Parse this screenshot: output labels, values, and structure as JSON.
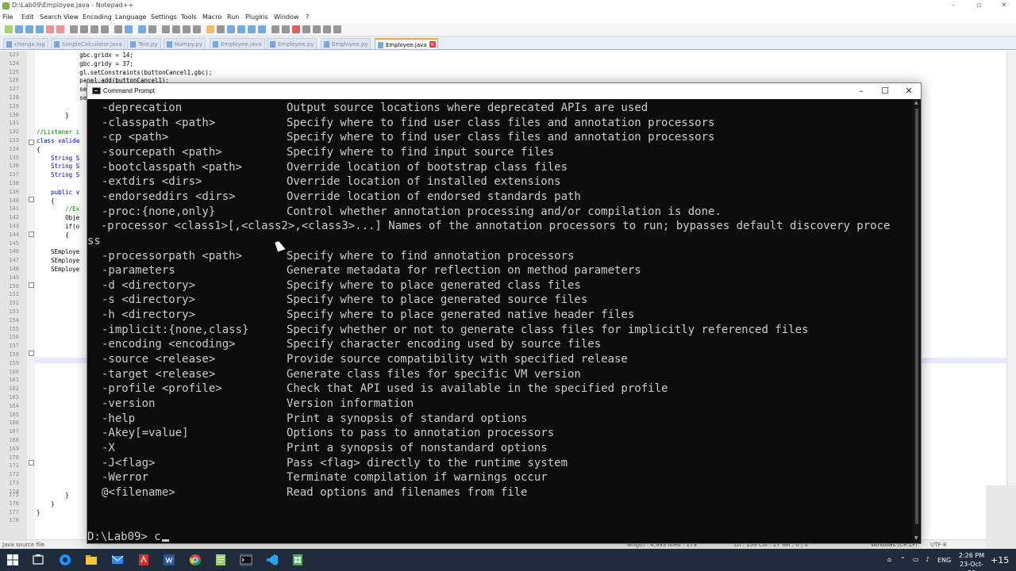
{
  "npp": {
    "title": "D:\\Lab09\\Employee.java - Notepad++",
    "menu": [
      "File",
      "Edit",
      "Search",
      "View",
      "Encoding",
      "Language",
      "Settings",
      "Tools",
      "Macro",
      "Run",
      "Plugins",
      "Window",
      "?"
    ],
    "tabs": [
      "change.log",
      "SimpleCalculator.java",
      "Test.py",
      "Numpy.py",
      "Employee.java",
      "Employee.py",
      "Employee.py",
      "Employee.java"
    ],
    "active_tab": 7,
    "code_lines": [
      {
        "n": "123",
        "t": "            gbc.gridx = 14;"
      },
      {
        "n": "124",
        "t": "            gbc.gridy = 37;"
      },
      {
        "n": "125",
        "t": "            gl.setConstraints(buttonCancel1,gbc);"
      },
      {
        "n": "126",
        "t": "            panel.add(buttonCancel1);"
      },
      {
        "n": "127",
        "t": "            setS"
      },
      {
        "n": "128",
        "t": "            setV"
      },
      {
        "n": "129",
        "t": ""
      },
      {
        "n": "130",
        "t": "        }"
      },
      {
        "n": "131",
        "t": ""
      },
      {
        "n": "132",
        "t": "//Listener i"
      },
      {
        "n": "133",
        "t": "class valida"
      },
      {
        "n": "134",
        "t": "{"
      },
      {
        "n": "135",
        "t": "    String S"
      },
      {
        "n": "136",
        "t": "    String S"
      },
      {
        "n": "137",
        "t": "    String S"
      },
      {
        "n": "138",
        "t": ""
      },
      {
        "n": "139",
        "t": "    public v"
      },
      {
        "n": "140",
        "t": "    {"
      },
      {
        "n": "141",
        "t": "        //Ex"
      },
      {
        "n": "142",
        "t": "        Obje"
      },
      {
        "n": "143",
        "t": "        if(o"
      },
      {
        "n": "144",
        "t": "        {"
      },
      {
        "n": "145",
        "t": ""
      },
      {
        "n": "146",
        "t": "    SEmploye"
      },
      {
        "n": "147",
        "t": "    SEmploye"
      },
      {
        "n": "148",
        "t": "    SEmploye"
      }
    ],
    "tail_lines": [
      {
        "n": "175",
        "t": "        }"
      },
      {
        "n": "176",
        "t": "    }"
      },
      {
        "n": "177",
        "t": "}"
      },
      {
        "n": "178",
        "t": ""
      }
    ],
    "status": {
      "filetype": "Java source file",
      "length": "length : 4,993    lines : 179",
      "position": "Ln : 159    Col : 17    Sel : 0 | 0",
      "eol": "Windows (CR LF)",
      "encoding": "UTF-8"
    }
  },
  "cmd": {
    "title": "Command Prompt",
    "lines": [
      {
        "opt": "-deprecation",
        "desc": "Output source locations where deprecated APIs are used"
      },
      {
        "opt": "-classpath <path>",
        "desc": "Specify where to find user class files and annotation processors"
      },
      {
        "opt": "-cp <path>",
        "desc": "Specify where to find user class files and annotation processors"
      },
      {
        "opt": "-sourcepath <path>",
        "desc": "Specify where to find input source files"
      },
      {
        "opt": "-bootclasspath <path>",
        "desc": "Override location of bootstrap class files"
      },
      {
        "opt": "-extdirs <dirs>",
        "desc": "Override location of installed extensions"
      },
      {
        "opt": "-endorseddirs <dirs>",
        "desc": "Override location of endorsed standards path"
      },
      {
        "opt": "-proc:{none,only}",
        "desc": "Control whether annotation processing and/or compilation is done."
      }
    ],
    "wrapped_line_1": "  -processor <class1>[,<class2>,<class3>...] Names of the annotation processors to run; bypasses default discovery proce",
    "wrapped_line_2": "ss",
    "lines2": [
      {
        "opt": "-processorpath <path>",
        "desc": "Specify where to find annotation processors"
      },
      {
        "opt": "-parameters",
        "desc": "Generate metadata for reflection on method parameters"
      },
      {
        "opt": "-d <directory>",
        "desc": "Specify where to place generated class files"
      },
      {
        "opt": "-s <directory>",
        "desc": "Specify where to place generated source files"
      },
      {
        "opt": "-h <directory>",
        "desc": "Specify where to place generated native header files"
      },
      {
        "opt": "-implicit:{none,class}",
        "desc": "Specify whether or not to generate class files for implicitly referenced files"
      },
      {
        "opt": "-encoding <encoding>",
        "desc": "Specify character encoding used by source files"
      },
      {
        "opt": "-source <release>",
        "desc": "Provide source compatibility with specified release"
      },
      {
        "opt": "-target <release>",
        "desc": "Generate class files for specific VM version"
      },
      {
        "opt": "-profile <profile>",
        "desc": "Check that API used is available in the specified profile"
      },
      {
        "opt": "-version",
        "desc": "Version information"
      },
      {
        "opt": "-help",
        "desc": "Print a synopsis of standard options"
      },
      {
        "opt": "-Akey[=value]",
        "desc": "Options to pass to annotation processors"
      },
      {
        "opt": "-X",
        "desc": "Print a synopsis of nonstandard options"
      },
      {
        "opt": "-J<flag>",
        "desc": "Pass <flag> directly to the runtime system"
      },
      {
        "opt": "-Werror",
        "desc": "Terminate compilation if warnings occur"
      },
      {
        "opt": "@<filename>",
        "desc": "Read options and filenames from file"
      }
    ],
    "prompt": "D:\\Lab09> c"
  },
  "taskbar": {
    "time": "2:26 PM",
    "date": "23-Oct-20",
    "lang": "ENG",
    "badge": "+15"
  },
  "colors": {
    "cmd_bg": "#0c0c0c",
    "cmd_text": "#cccccc",
    "taskbar": "#1f2c3b"
  }
}
